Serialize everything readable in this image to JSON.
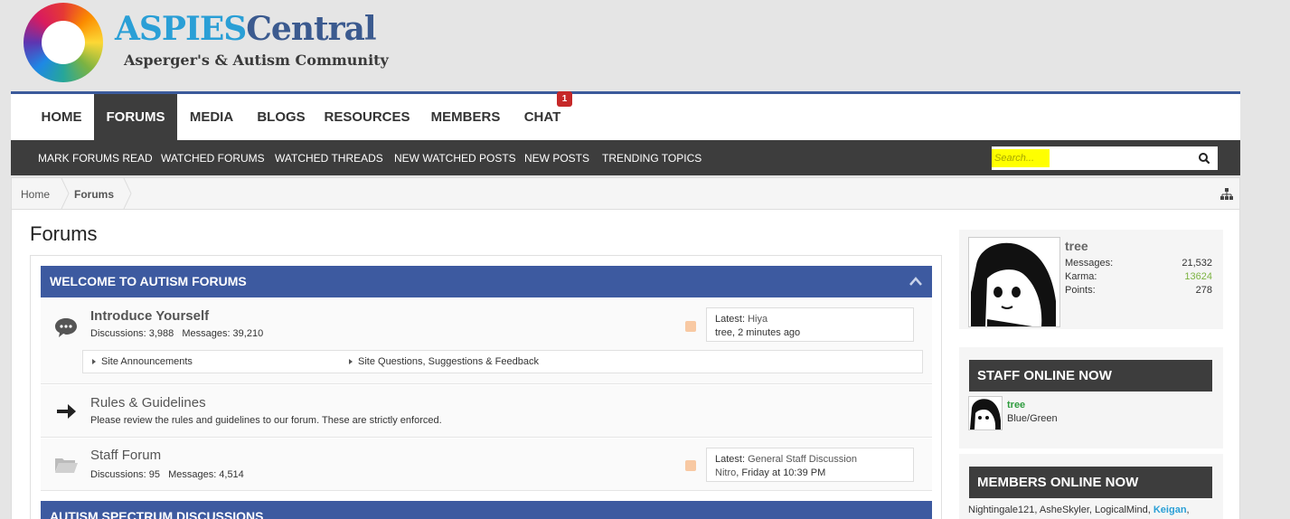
{
  "logo": {
    "title_part1": "ASPIES",
    "title_part2": "Central",
    "subtitle": "Asperger's & Autism Community"
  },
  "topnav": {
    "tabs": [
      {
        "label": "HOME"
      },
      {
        "label": "FORUMS",
        "active": true
      },
      {
        "label": "MEDIA"
      },
      {
        "label": "BLOGS"
      },
      {
        "label": "RESOURCES"
      },
      {
        "label": "MEMBERS"
      },
      {
        "label": "CHAT",
        "badge": "1"
      }
    ]
  },
  "subnav": {
    "links": [
      "MARK FORUMS READ",
      "WATCHED FORUMS",
      "WATCHED THREADS",
      "NEW WATCHED POSTS",
      "NEW POSTS",
      "TRENDING TOPICS"
    ],
    "search_placeholder": "Search..."
  },
  "breadcrumb": {
    "items": [
      "Home",
      "Forums"
    ]
  },
  "page": {
    "title": "Forums"
  },
  "categories": [
    {
      "title": "WELCOME TO AUTISM FORUMS"
    },
    {
      "title": "AUTISM SPECTRUM DISCUSSIONS"
    }
  ],
  "nodes": {
    "introduce": {
      "title": "Introduce Yourself",
      "discussions_label": "Discussions:",
      "discussions": "3,988",
      "messages_label": "Messages:",
      "messages": "39,210",
      "latest_label": "Latest:",
      "latest_thread": "Hiya",
      "latest_user_time": "tree, 2 minutes ago",
      "subforums": [
        "Site Announcements",
        "Site Questions, Suggestions & Feedback"
      ]
    },
    "rules": {
      "title": "Rules & Guidelines",
      "description": "Please review the rules and guidelines to our forum. These are strictly enforced."
    },
    "staff": {
      "title": "Staff Forum",
      "discussions_label": "Discussions:",
      "discussions": "95",
      "messages_label": "Messages:",
      "messages": "4,514",
      "latest_label": "Latest:",
      "latest_thread": "General Staff Discussion",
      "latest_user": "Nitro",
      "latest_time": ", Friday at 10:39 PM"
    }
  },
  "sidebar": {
    "user": {
      "name": "tree",
      "messages_label": "Messages:",
      "messages": "21,532",
      "karma_label": "Karma:",
      "karma": "13624",
      "points_label": "Points:",
      "points": "278"
    },
    "staff_online": {
      "heading": "STAFF ONLINE NOW",
      "name": "tree",
      "title": "Blue/Green"
    },
    "members_online": {
      "heading": "MEMBERS ONLINE NOW",
      "names_plain": "Nightingale121, AsheSkyler, LogicalMind, ",
      "names_highlight": "Keigan",
      "names_tail": ","
    }
  },
  "colors": {
    "accent_blue": "#3d5aa0",
    "dark_bar": "#3d3d3d",
    "search_highlight": "#ffff00",
    "karma_green": "#7cb342",
    "staff_green": "#2e9c3e",
    "badge_red": "#c62828"
  }
}
